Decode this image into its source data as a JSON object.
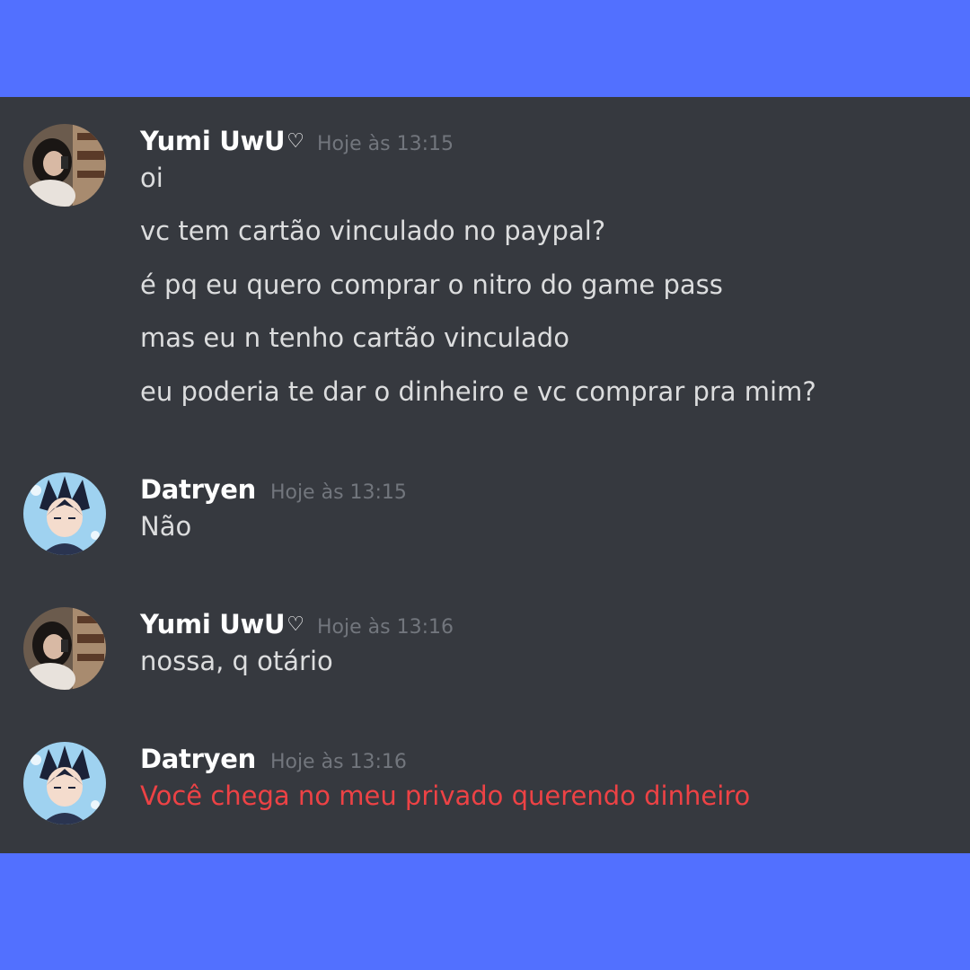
{
  "colors": {
    "frame_background": "#5270ff",
    "chat_background": "#36393f",
    "username": "#ffffff",
    "timestamp": "#72767d",
    "message_text": "#dcddde",
    "message_alert_text": "#ed4245"
  },
  "messages": [
    {
      "author": "Yumi UwU",
      "author_suffix": "♡",
      "avatar": "photo-avatar-icon",
      "timestamp": "Hoje às 13:15",
      "lines": [
        "oi",
        "vc tem cartão vinculado no paypal?",
        "é pq eu quero comprar o nitro do game pass",
        "mas eu n tenho cartão vinculado",
        "eu poderia te dar o dinheiro e vc comprar pra mim?"
      ]
    },
    {
      "author": "Datryen",
      "avatar": "anime-avatar-icon",
      "timestamp": "Hoje às 13:15",
      "lines": [
        "Não"
      ]
    },
    {
      "author": "Yumi UwU",
      "author_suffix": "♡",
      "avatar": "photo-avatar-icon",
      "timestamp": "Hoje às 13:16",
      "lines": [
        "nossa, q otário"
      ]
    },
    {
      "author": "Datryen",
      "avatar": "anime-avatar-icon",
      "timestamp": "Hoje às 13:16",
      "lines": [
        "Você chega no meu privado querendo dinheiro"
      ],
      "line_color": "#ed4245"
    }
  ]
}
